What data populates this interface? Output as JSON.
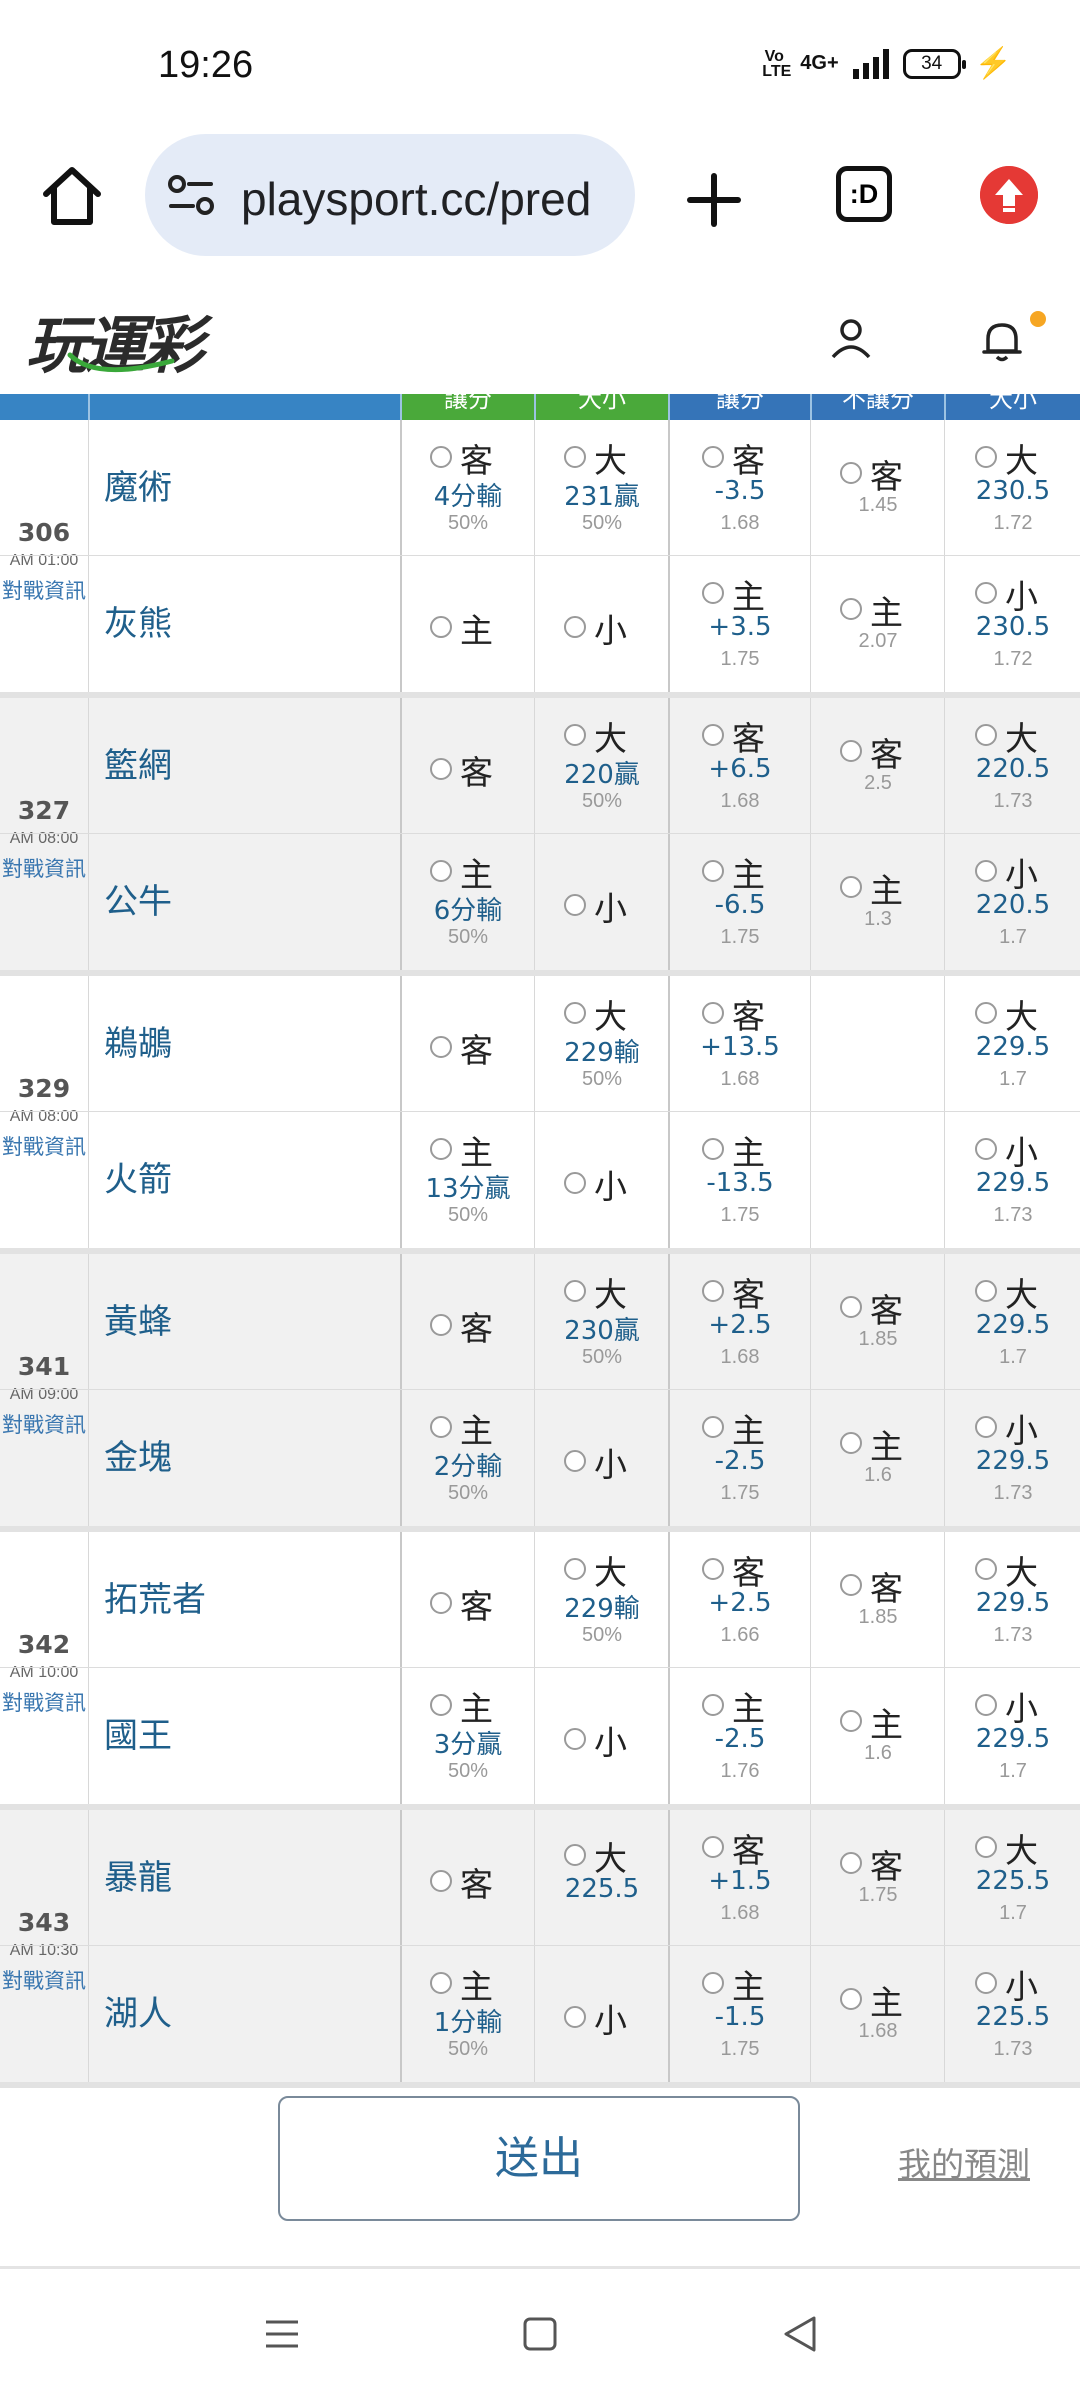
{
  "status": {
    "time": "19:26",
    "volte": "Vo LTE",
    "network": "4G+",
    "battery": "34"
  },
  "browser": {
    "url": "playsport.cc/pred"
  },
  "site": {
    "logo_text": "玩運彩"
  },
  "table": {
    "headers": [
      "讓分",
      "大小",
      "讓分",
      "不讓分",
      "大小"
    ],
    "games": [
      {
        "num": "306",
        "time": "AM 01:00",
        "info": "對戰資訊",
        "rows": [
          {
            "team": "魔術",
            "c1": {
              "pick": "客",
              "val": "4分輸",
              "sub": "50%"
            },
            "c2": {
              "pick": "大",
              "val": "231贏",
              "sub": "50%"
            },
            "c3": {
              "pick": "客",
              "val": "-3.5",
              "sub": "1.68"
            },
            "c4": {
              "pick": "客",
              "val": "",
              "sub": "1.45"
            },
            "c5": {
              "pick": "大",
              "val": "230.5",
              "sub": "1.72"
            }
          },
          {
            "team": "灰熊",
            "c1": {
              "pick": "主",
              "val": "",
              "sub": ""
            },
            "c2": {
              "pick": "小",
              "val": "",
              "sub": ""
            },
            "c3": {
              "pick": "主",
              "val": "+3.5",
              "sub": "1.75"
            },
            "c4": {
              "pick": "主",
              "val": "",
              "sub": "2.07"
            },
            "c5": {
              "pick": "小",
              "val": "230.5",
              "sub": "1.72"
            }
          }
        ]
      },
      {
        "num": "327",
        "time": "AM 08:00",
        "info": "對戰資訊",
        "rows": [
          {
            "team": "籃網",
            "c1": {
              "pick": "客",
              "val": "",
              "sub": ""
            },
            "c2": {
              "pick": "大",
              "val": "220贏",
              "sub": "50%"
            },
            "c3": {
              "pick": "客",
              "val": "+6.5",
              "sub": "1.68"
            },
            "c4": {
              "pick": "客",
              "val": "",
              "sub": "2.5"
            },
            "c5": {
              "pick": "大",
              "val": "220.5",
              "sub": "1.73"
            }
          },
          {
            "team": "公牛",
            "c1": {
              "pick": "主",
              "val": "6分輸",
              "sub": "50%"
            },
            "c2": {
              "pick": "小",
              "val": "",
              "sub": ""
            },
            "c3": {
              "pick": "主",
              "val": "-6.5",
              "sub": "1.75"
            },
            "c4": {
              "pick": "主",
              "val": "",
              "sub": "1.3"
            },
            "c5": {
              "pick": "小",
              "val": "220.5",
              "sub": "1.7"
            }
          }
        ]
      },
      {
        "num": "329",
        "time": "AM 08:00",
        "info": "對戰資訊",
        "rows": [
          {
            "team": "鵜鶘",
            "c1": {
              "pick": "客",
              "val": "",
              "sub": ""
            },
            "c2": {
              "pick": "大",
              "val": "229輸",
              "sub": "50%"
            },
            "c3": {
              "pick": "客",
              "val": "+13.5",
              "sub": "1.68"
            },
            "c4": null,
            "c5": {
              "pick": "大",
              "val": "229.5",
              "sub": "1.7"
            }
          },
          {
            "team": "火箭",
            "c1": {
              "pick": "主",
              "val": "13分贏",
              "sub": "50%"
            },
            "c2": {
              "pick": "小",
              "val": "",
              "sub": ""
            },
            "c3": {
              "pick": "主",
              "val": "-13.5",
              "sub": "1.75"
            },
            "c4": null,
            "c5": {
              "pick": "小",
              "val": "229.5",
              "sub": "1.73"
            }
          }
        ]
      },
      {
        "num": "341",
        "time": "AM 09:00",
        "info": "對戰資訊",
        "rows": [
          {
            "team": "黃蜂",
            "c1": {
              "pick": "客",
              "val": "",
              "sub": ""
            },
            "c2": {
              "pick": "大",
              "val": "230贏",
              "sub": "50%"
            },
            "c3": {
              "pick": "客",
              "val": "+2.5",
              "sub": "1.68"
            },
            "c4": {
              "pick": "客",
              "val": "",
              "sub": "1.85"
            },
            "c5": {
              "pick": "大",
              "val": "229.5",
              "sub": "1.7"
            }
          },
          {
            "team": "金塊",
            "c1": {
              "pick": "主",
              "val": "2分輸",
              "sub": "50%"
            },
            "c2": {
              "pick": "小",
              "val": "",
              "sub": ""
            },
            "c3": {
              "pick": "主",
              "val": "-2.5",
              "sub": "1.75"
            },
            "c4": {
              "pick": "主",
              "val": "",
              "sub": "1.6"
            },
            "c5": {
              "pick": "小",
              "val": "229.5",
              "sub": "1.73"
            }
          }
        ]
      },
      {
        "num": "342",
        "time": "AM 10:00",
        "info": "對戰資訊",
        "rows": [
          {
            "team": "拓荒者",
            "c1": {
              "pick": "客",
              "val": "",
              "sub": ""
            },
            "c2": {
              "pick": "大",
              "val": "229輸",
              "sub": "50%"
            },
            "c3": {
              "pick": "客",
              "val": "+2.5",
              "sub": "1.66"
            },
            "c4": {
              "pick": "客",
              "val": "",
              "sub": "1.85"
            },
            "c5": {
              "pick": "大",
              "val": "229.5",
              "sub": "1.73"
            }
          },
          {
            "team": "國王",
            "c1": {
              "pick": "主",
              "val": "3分贏",
              "sub": "50%"
            },
            "c2": {
              "pick": "小",
              "val": "",
              "sub": ""
            },
            "c3": {
              "pick": "主",
              "val": "-2.5",
              "sub": "1.76"
            },
            "c4": {
              "pick": "主",
              "val": "",
              "sub": "1.6"
            },
            "c5": {
              "pick": "小",
              "val": "229.5",
              "sub": "1.7"
            }
          }
        ]
      },
      {
        "num": "343",
        "time": "AM 10:30",
        "info": "對戰資訊",
        "rows": [
          {
            "team": "暴龍",
            "c1": {
              "pick": "客",
              "val": "",
              "sub": ""
            },
            "c2": {
              "pick": "大",
              "val": "225.5",
              "sub": ""
            },
            "c3": {
              "pick": "客",
              "val": "+1.5",
              "sub": "1.68"
            },
            "c4": {
              "pick": "客",
              "val": "",
              "sub": "1.75"
            },
            "c5": {
              "pick": "大",
              "val": "225.5",
              "sub": "1.7"
            }
          },
          {
            "team": "湖人",
            "c1": {
              "pick": "主",
              "val": "1分輸",
              "sub": "50%"
            },
            "c2": {
              "pick": "小",
              "val": "",
              "sub": ""
            },
            "c3": {
              "pick": "主",
              "val": "-1.5",
              "sub": "1.75"
            },
            "c4": {
              "pick": "主",
              "val": "",
              "sub": "1.68"
            },
            "c5": {
              "pick": "小",
              "val": "225.5",
              "sub": "1.73"
            }
          }
        ]
      }
    ]
  },
  "footer": {
    "submit_label": "送出",
    "my_predictions_label": "我的預測"
  },
  "icons": {
    "home": "home-icon",
    "site_settings": "tune-icon",
    "new_tab": "plus-icon",
    "tabs": "tab-switcher-icon",
    "update": "upgrade-icon",
    "user": "user-icon",
    "notifications": "bell-icon",
    "nav_menu": "menu-icon",
    "nav_home": "square-icon",
    "nav_back": "back-triangle-icon"
  },
  "colors": {
    "team_text": "#1f5f8b",
    "header_blue": "#3574b8",
    "header_green": "#4aa93a",
    "update_badge": "#e53935",
    "notification_dot": "#f6a623"
  }
}
